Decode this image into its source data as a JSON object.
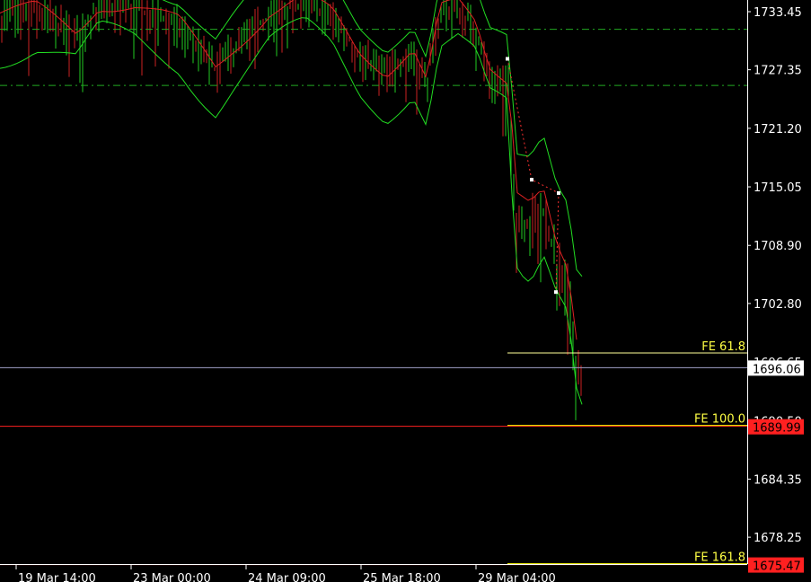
{
  "chart_data": {
    "type": "candlestick",
    "y_axis": {
      "ylim": [
        1675.2,
        1735.2
      ],
      "ticks": [
        "1733.45",
        "1727.35",
        "1721.20",
        "1715.05",
        "1708.90",
        "1702.80",
        "1696.65",
        "1690.50",
        "1684.35",
        "1678.25"
      ]
    },
    "x_axis": {
      "ticks": [
        "19 Mar 14:00",
        "23 Mar 00:00",
        "24 Mar 09:00",
        "25 Mar 18:00",
        "29 Mar 04:00"
      ]
    },
    "current_price": {
      "label": "1696.06",
      "value": 1696.06,
      "color": "#ffffff"
    },
    "horizontal_levels": [
      {
        "name": "FE 61.8",
        "label": "FE 61.8",
        "value": 1697.6,
        "color": "#ffff99"
      },
      {
        "name": "FE 100.0",
        "label": "FE 100.0",
        "value": 1689.99,
        "color": "#ffff00",
        "price_label": "1689.99",
        "box_color": "#ff2020"
      },
      {
        "name": "FE 161.8",
        "label": "FE 161.8",
        "value": 1675.47,
        "color": "#ffff00",
        "price_label": "1675.47",
        "box_color": "#ff2020"
      }
    ],
    "dashed_levels": [
      {
        "value": 1731.6,
        "color": "#22aa22"
      },
      {
        "value": 1725.7,
        "color": "#22aa22"
      }
    ],
    "series": [
      {
        "name": "",
        "kind": "bollinger-upper",
        "color": "#22dd22"
      },
      {
        "name": "",
        "kind": "bollinger-lower",
        "color": "#22dd22"
      },
      {
        "name": "",
        "kind": "moving-average",
        "color": "#dd2222"
      },
      {
        "name": "",
        "kind": "price",
        "color": "#22cc22"
      }
    ],
    "swing_points": [
      {
        "label": "",
        "value": 1728.5
      },
      {
        "label": "",
        "value": 1715.8
      },
      {
        "label": "",
        "value": 1714.4
      },
      {
        "label": "",
        "value": 1704.0
      }
    ],
    "grid": false
  }
}
